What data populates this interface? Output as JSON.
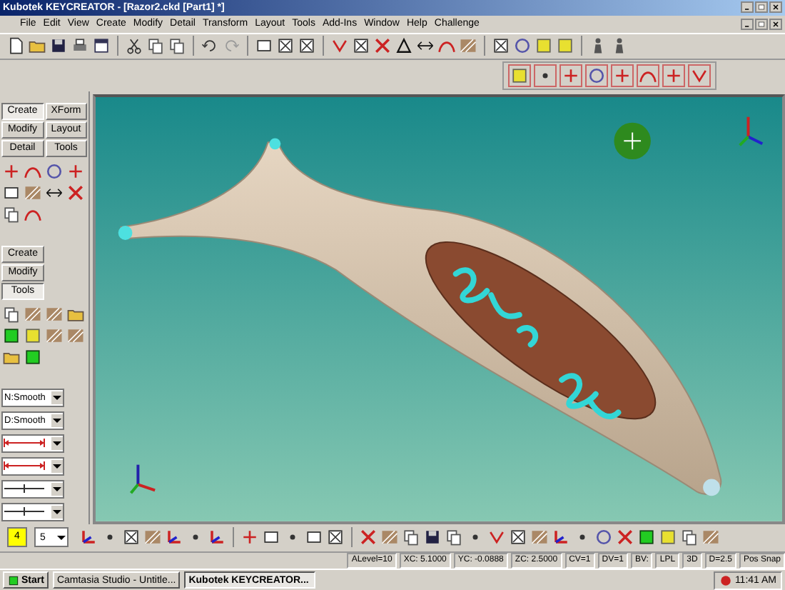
{
  "window": {
    "title": "Kubotek KEYCREATOR - [Razor2.ckd [Part1] *]"
  },
  "menu": [
    "File",
    "Edit",
    "View",
    "Create",
    "Modify",
    "Detail",
    "Transform",
    "Layout",
    "Tools",
    "Add-Ins",
    "Window",
    "Help",
    "Challenge"
  ],
  "palette_tabs": [
    {
      "label": "Create",
      "selected": true
    },
    {
      "label": "XForm",
      "selected": false
    },
    {
      "label": "Modify",
      "selected": false
    },
    {
      "label": "Layout",
      "selected": false
    },
    {
      "label": "Detail",
      "selected": false
    },
    {
      "label": "Tools",
      "selected": false
    }
  ],
  "tools_tabs": [
    {
      "label": "Create",
      "selected": false
    },
    {
      "label": "Modify",
      "selected": false
    },
    {
      "label": "Tools",
      "selected": true
    }
  ],
  "dropdowns": [
    {
      "kind": "text",
      "value": "N:Smooth"
    },
    {
      "kind": "text",
      "value": "D:Smooth"
    },
    {
      "kind": "dimension",
      "color": "#cc2222"
    },
    {
      "kind": "dimension",
      "color": "#cc2222"
    },
    {
      "kind": "tick",
      "color": "#333333"
    },
    {
      "kind": "tick",
      "color": "#333333"
    }
  ],
  "bottom_toolbar": {
    "level": "4",
    "layer": "5"
  },
  "status": [
    "ALevel=10",
    "XC: 5.1000",
    "YC: -0.0888",
    "ZC: 2.5000",
    "CV=1",
    "DV=1",
    "BV:",
    "LPL",
    "3D",
    "D=2.5",
    "Pos Snap"
  ],
  "taskbar": {
    "start": "Start",
    "tasks": [
      {
        "label": "Camtasia Studio - Untitle...",
        "selected": false
      },
      {
        "label": "Kubotek KEYCREATOR...",
        "selected": true
      }
    ],
    "clock": "11:41 AM"
  }
}
